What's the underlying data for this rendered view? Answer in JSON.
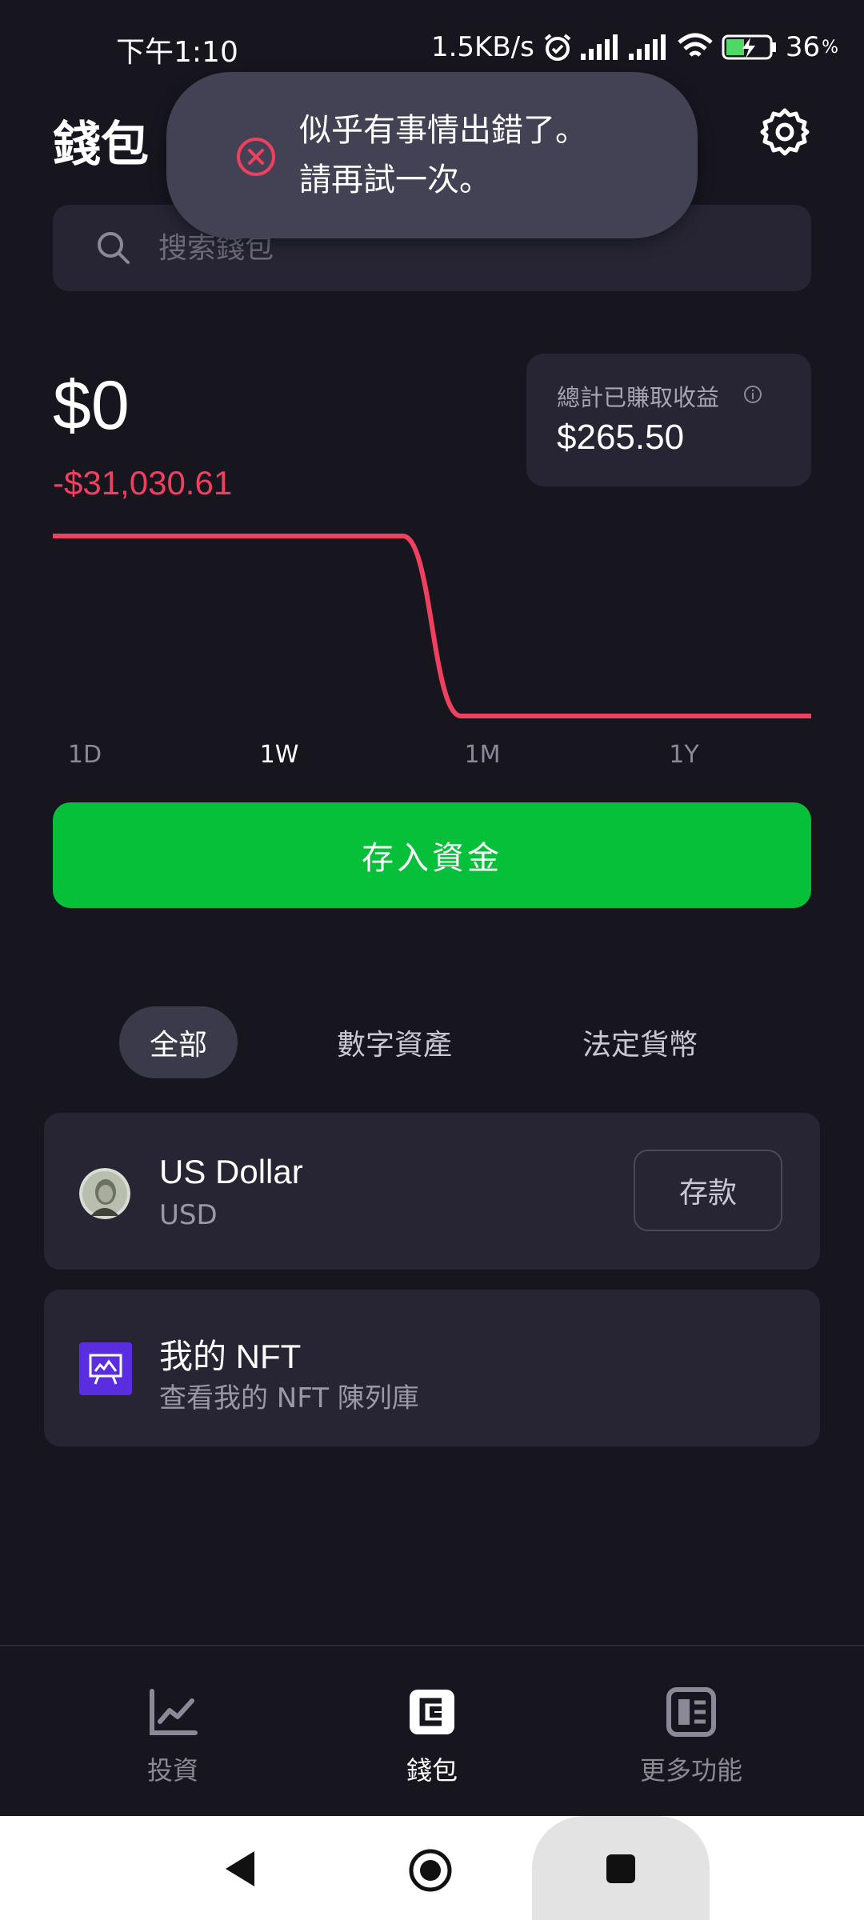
{
  "status_bar": {
    "time": "下午1:10",
    "net_speed": "1.5KB/s",
    "battery": "36"
  },
  "header": {
    "title": "錢包",
    "settings_icon": "gear-icon"
  },
  "search": {
    "placeholder": "搜索錢包",
    "value": ""
  },
  "toast": {
    "line1": "似乎有事情出錯了。",
    "line2": "請再試一次。",
    "icon": "error-circle-x-icon",
    "icon_color": "#f0405f"
  },
  "balance": {
    "amount": "$0",
    "change": "-$31,030.61",
    "change_color": "#f0405f"
  },
  "earnings": {
    "label": "總計已賺取收益",
    "value": "$265.50"
  },
  "chart_data": {
    "type": "line",
    "series": [
      {
        "values": [
          1,
          1,
          1,
          1,
          1,
          1,
          1,
          0,
          0,
          0,
          0,
          0,
          0,
          0
        ]
      }
    ],
    "line_color": "#f0405f",
    "grid": false,
    "range_tabs": [
      "1D",
      "1W",
      "1M",
      "1Y"
    ],
    "active_range": "1W"
  },
  "deposit_button": {
    "label": "存入資金",
    "color": "#06c03a"
  },
  "filter_tabs": {
    "all": "全部",
    "digital": "數字資產",
    "fiat": "法定貨幣",
    "active": "全部"
  },
  "assets": {
    "usd": {
      "name": "US Dollar",
      "code": "USD",
      "action": "存款"
    },
    "nft": {
      "name": "我的 NFT",
      "subtitle": "查看我的 NFT 陳列庫"
    }
  },
  "bottom_nav": {
    "invest": "投資",
    "wallet": "錢包",
    "more": "更多功能",
    "active": "錢包"
  }
}
